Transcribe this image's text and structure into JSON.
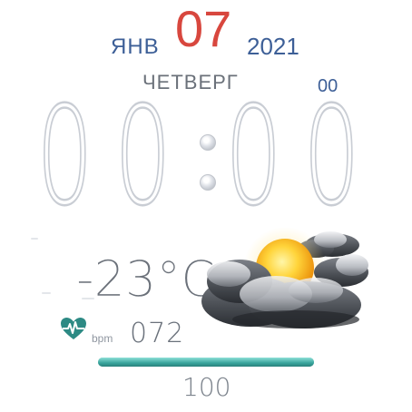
{
  "date": {
    "month": "ЯНВ",
    "day": "07",
    "year": "2021",
    "weekday": "ЧЕТВЕРГ"
  },
  "time": {
    "hours": "00",
    "minutes": "00",
    "seconds": "00"
  },
  "weather": {
    "temperature": "-23°C",
    "condition_icon": "sun-behind-clouds-icon"
  },
  "heart_rate": {
    "unit": "bpm",
    "value": "072",
    "icon": "heart-pulse-icon"
  },
  "battery": {
    "value": "100",
    "level": 1.0
  },
  "colors": {
    "blue": "#3d5f97",
    "red": "#d8473e",
    "grey_text": "#6b717a",
    "teal": "#2f8e88"
  }
}
